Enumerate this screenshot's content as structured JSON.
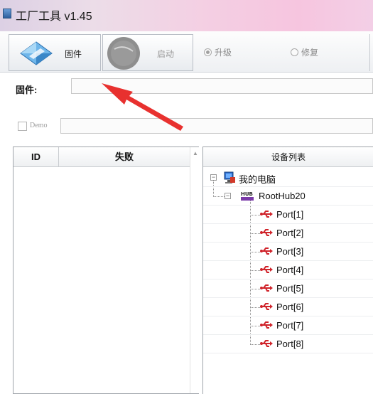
{
  "window": {
    "title": "工厂工具 v1.45"
  },
  "toolbar": {
    "firmware_label": "固件",
    "start_label": "启动",
    "upgrade_label": "升级",
    "repair_label": "修复",
    "upgrade_selected": true
  },
  "firmware_row": {
    "label": "固件:",
    "value": ""
  },
  "demo_row": {
    "label": "Demo",
    "checked": false,
    "value": ""
  },
  "fail_table": {
    "columns": [
      "ID",
      "失败"
    ],
    "rows": []
  },
  "device_tree": {
    "header": "设备列表",
    "root": "我的电脑",
    "hub": "RootHub20",
    "ports": [
      "Port[1]",
      "Port[2]",
      "Port[3]",
      "Port[4]",
      "Port[5]",
      "Port[6]",
      "Port[7]",
      "Port[8]"
    ]
  },
  "colors": {
    "usb_red": "#d0232a",
    "arrow_red": "#e8312f"
  },
  "icons": {
    "firmware": "diamond-icon",
    "start": "start-disc-icon",
    "computer": "computer-icon",
    "hub": "hub-icon",
    "port": "usb-icon"
  }
}
